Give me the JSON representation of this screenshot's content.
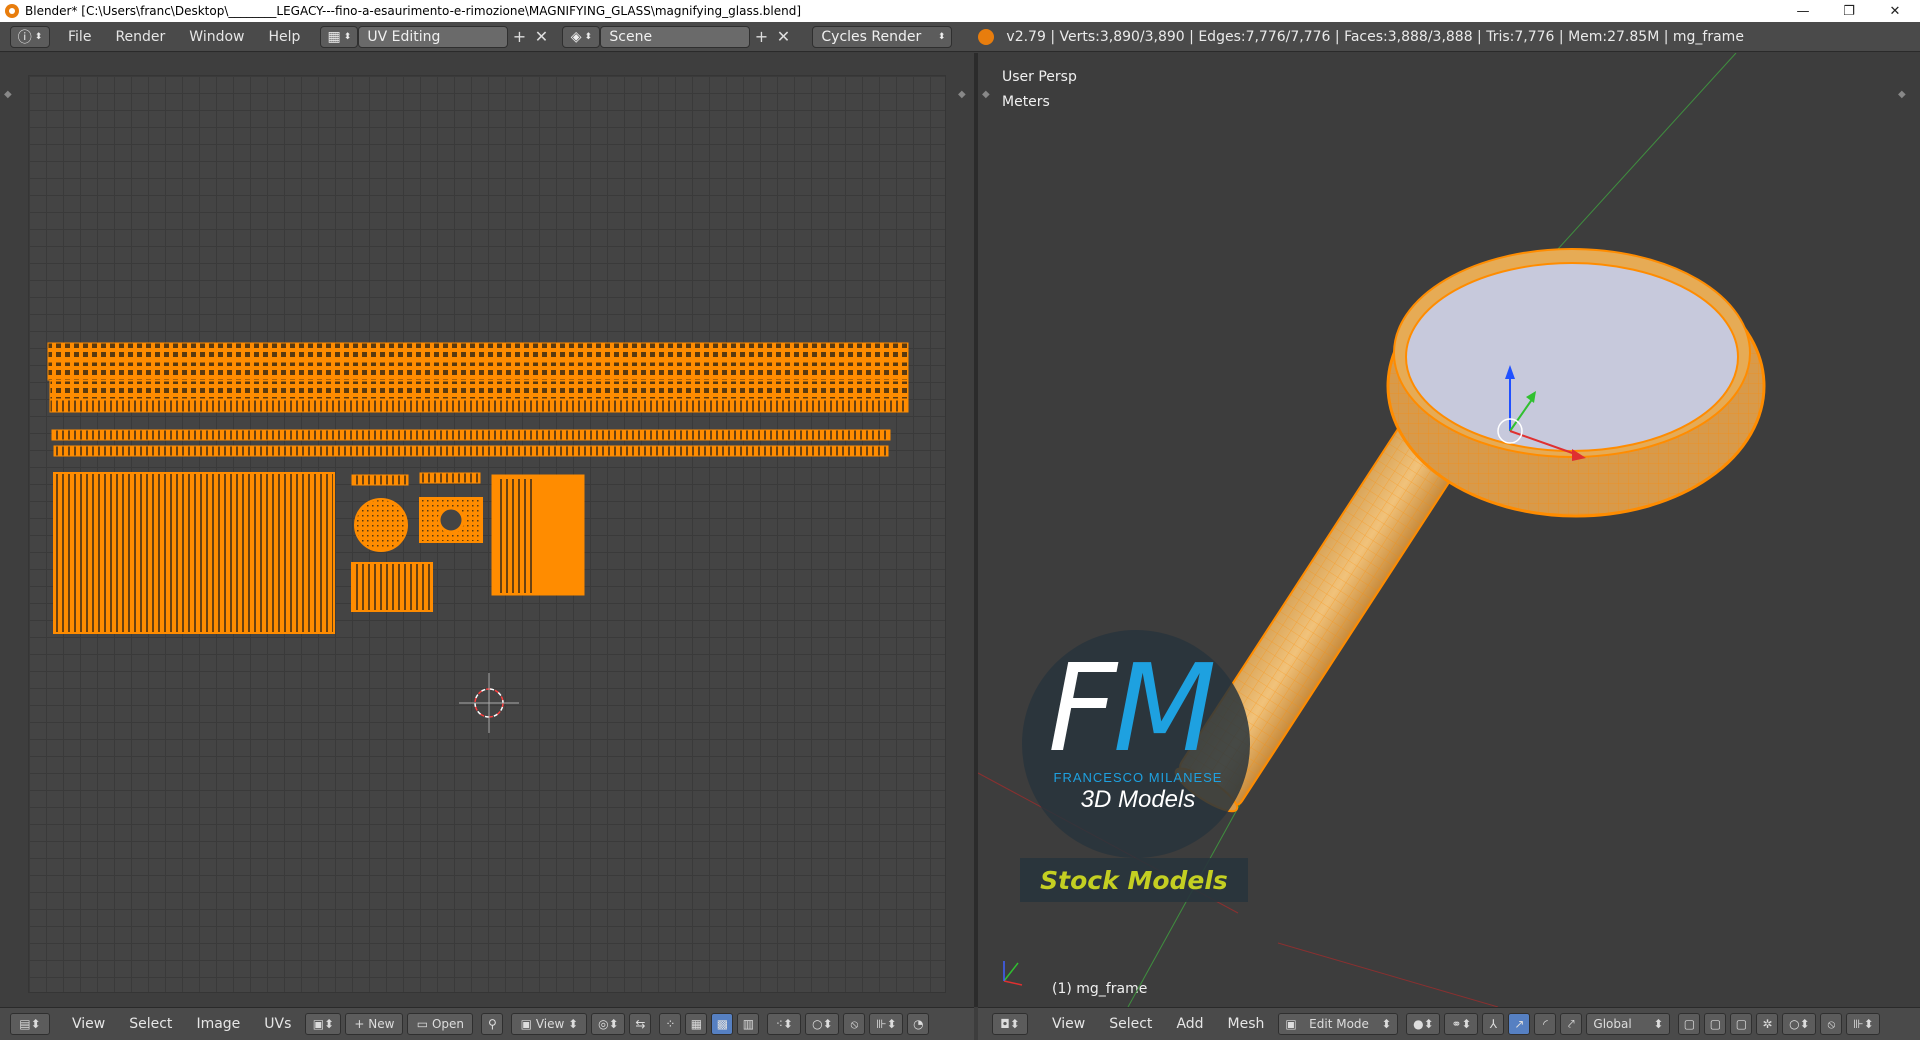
{
  "window": {
    "title": "Blender* [C:\\Users\\franc\\Desktop\\________LEGACY---fino-a-esaurimento-e-rimozione\\MAGNIFYING_GLASS\\magnifying_glass.blend]",
    "minimize": "—",
    "restore": "❐",
    "close": "✕"
  },
  "info_header": {
    "menus": [
      "File",
      "Render",
      "Window",
      "Help"
    ],
    "layout": "UV Editing",
    "scene": "Scene",
    "engine": "Cycles Render",
    "stats": "v2.79 | Verts:3,890/3,890 | Edges:7,776/7,776 | Faces:3,888/3,888 | Tris:7,776 | Mem:27.85M | mg_frame"
  },
  "uv_editor": {
    "menus": [
      "View",
      "Select",
      "Image",
      "UVs"
    ],
    "new_label": "New",
    "open_label": "Open",
    "view_label": "View"
  },
  "viewport": {
    "view_name": "User Persp",
    "units": "Meters",
    "object_info": "(1) mg_frame",
    "menus": [
      "View",
      "Select",
      "Add",
      "Mesh"
    ],
    "mode": "Edit Mode",
    "orientation": "Global"
  },
  "watermark": {
    "brand": "FRANCESCO MILANESE",
    "subtitle": "3D Models",
    "stock": "Stock Models",
    "letter_f": "F",
    "letter_m": "M"
  },
  "colors": {
    "mesh_orange": "#ff8c00",
    "accent_blue": "#5680c2",
    "logo_blue": "#1ea1e0",
    "stock_yellow": "#c4cf22"
  }
}
